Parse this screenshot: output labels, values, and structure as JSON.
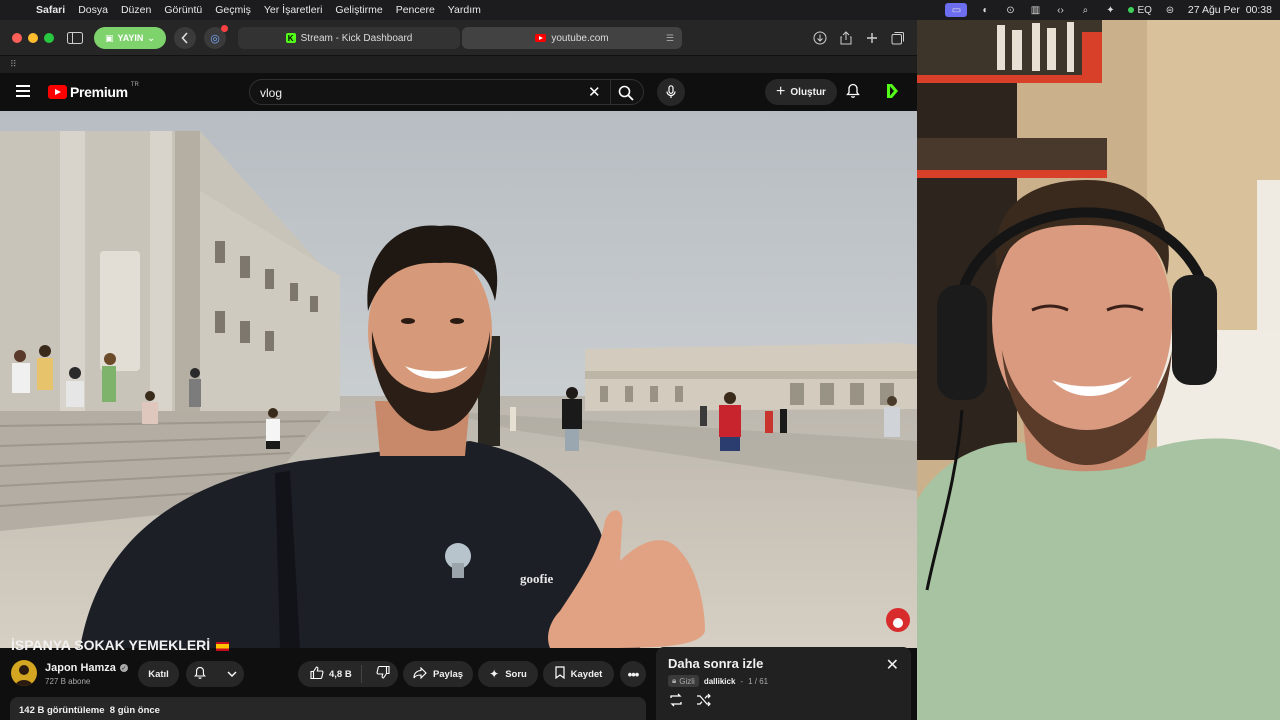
{
  "menubar": {
    "app": "Safari",
    "items": [
      "Dosya",
      "Düzen",
      "Görüntü",
      "Geçmiş",
      "Yer İşaretleri",
      "Geliştirme",
      "Pencere",
      "Yardım"
    ],
    "eq_label": "EQ",
    "datetime": "27 Ağu Per  00:38"
  },
  "safari": {
    "live_button": "YAYIN",
    "tabs": [
      {
        "title": "Stream - Kick Dashboard",
        "favicon": "kick-icon"
      },
      {
        "title": "youtube.com",
        "favicon": "youtube-icon"
      }
    ],
    "accent": "#7fd36d"
  },
  "youtube": {
    "logo_text": "Premium",
    "region": "TR",
    "search_value": "vlog",
    "create_label": "Oluştur",
    "brand_color": "#ff0000"
  },
  "video": {
    "title": "İSPANYA SOKAK YEMEKLERİ",
    "shirt_text": "goofie",
    "channel": {
      "name": "Japon Hamza",
      "subscribers": "727 B abone",
      "join_label": "Katıl"
    },
    "actions": {
      "likes": "4,8 B",
      "share": "Paylaş",
      "ask": "Soru",
      "save": "Kaydet"
    },
    "stats": "142 B görüntüleme  8 gün önce"
  },
  "watch_later": {
    "title": "Daha sonra izle",
    "privacy": "Gizli",
    "owner": "dallikick",
    "position": "1 / 61"
  }
}
